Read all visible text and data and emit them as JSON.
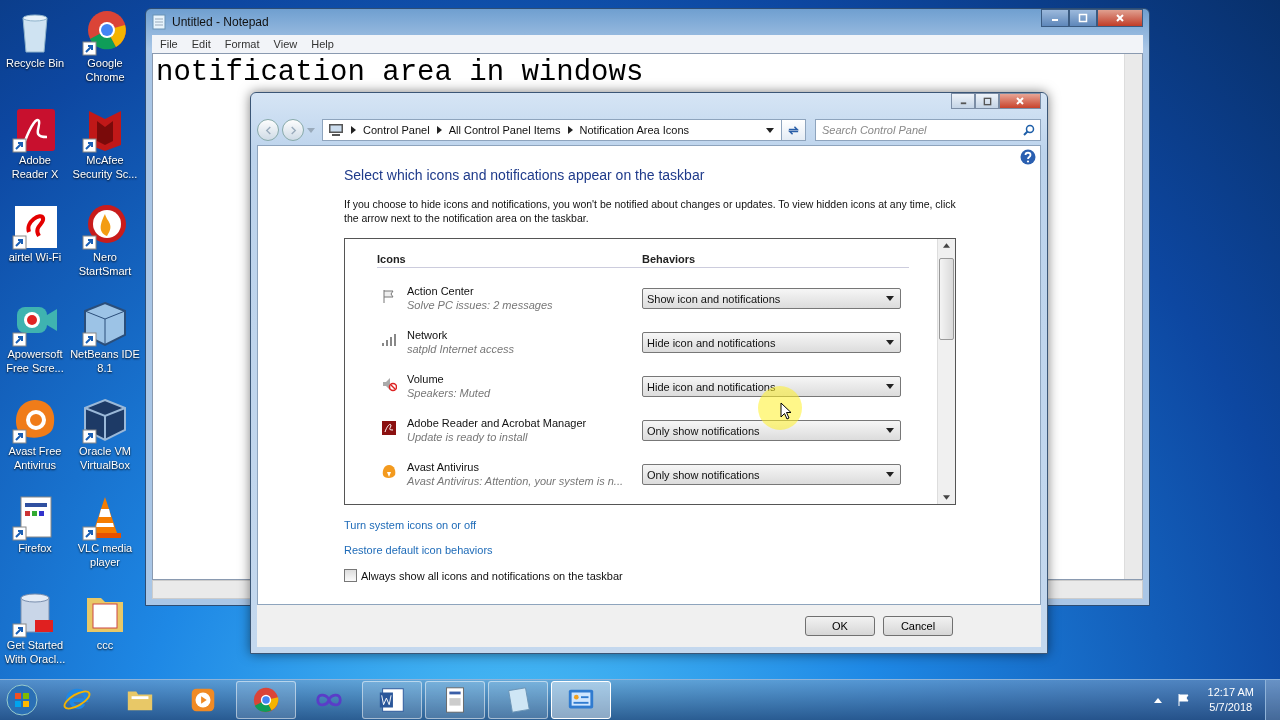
{
  "desktop_icons": [
    {
      "label": "Recycle Bin"
    },
    {
      "label": "Google Chrome"
    },
    {
      "label": "Adobe Reader X"
    },
    {
      "label": "McAfee Security Sc..."
    },
    {
      "label": "airtel Wi-Fi"
    },
    {
      "label": "Nero StartSmart"
    },
    {
      "label": "Apowersoft Free Scre..."
    },
    {
      "label": "NetBeans IDE 8.1"
    },
    {
      "label": "Avast Free Antivirus"
    },
    {
      "label": "Oracle VM VirtualBox"
    },
    {
      "label": "Firefox"
    },
    {
      "label": "VLC media player"
    },
    {
      "label": "Get Started With Oracl..."
    },
    {
      "label": "ccc"
    }
  ],
  "notepad": {
    "title": "Untitled - Notepad",
    "menu": [
      "File",
      "Edit",
      "Format",
      "View",
      "Help"
    ],
    "text": "notification area in windows"
  },
  "dialog": {
    "address": [
      "Control Panel",
      "All Control Panel Items",
      "Notification Area Icons"
    ],
    "search": {
      "placeholder": "Search Control Panel"
    },
    "heading": "Select which icons and notifications appear on the taskbar",
    "description": "If you choose to hide icons and notifications, you won't be notified about changes or updates. To view hidden icons at any time, click the arrow next to the notification area on the taskbar.",
    "columns": [
      "Icons",
      "Behaviors"
    ],
    "rows": [
      {
        "name": "Action Center",
        "status": "Solve PC issues: 2 messages",
        "behavior": "Show icon and notifications"
      },
      {
        "name": "Network",
        "status": "satpld Internet access",
        "behavior": "Hide icon and notifications"
      },
      {
        "name": "Volume",
        "status": "Speakers: Muted",
        "behavior": "Hide icon and notifications"
      },
      {
        "name": "Adobe Reader and Acrobat Manager",
        "status": "Update is ready to install",
        "behavior": "Only show notifications"
      },
      {
        "name": "Avast Antivirus",
        "status": "Avast Antivirus: Attention, your system is n...",
        "behavior": "Only show notifications"
      }
    ],
    "links": [
      "Turn system icons on or off",
      "Restore default icon behaviors"
    ],
    "always_show": {
      "label": "Always show all icons and notifications on the taskbar",
      "checked": false
    },
    "buttons": [
      "OK",
      "Cancel"
    ]
  },
  "taskbar": {
    "items": [
      {
        "open": false,
        "selected": false
      },
      {
        "open": false,
        "selected": false
      },
      {
        "open": false,
        "selected": false
      },
      {
        "open": true,
        "selected": false
      },
      {
        "open": false,
        "selected": false
      },
      {
        "open": true,
        "selected": false
      },
      {
        "open": true,
        "selected": false
      },
      {
        "open": true,
        "selected": false
      },
      {
        "open": true,
        "selected": true
      }
    ],
    "time": "12:17 AM",
    "date": "5/7/2018"
  }
}
